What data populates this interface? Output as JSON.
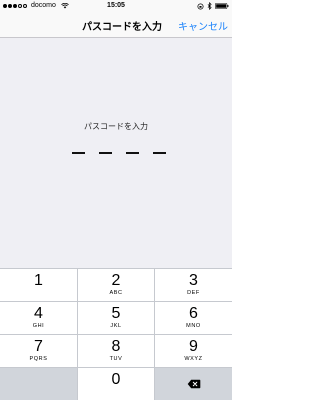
{
  "status_bar": {
    "carrier": "docomo",
    "time": "15:05"
  },
  "nav": {
    "title": "パスコードを入力",
    "cancel_label": "キャンセル"
  },
  "passcode": {
    "prompt": "パスコードを入力",
    "digits_entered": 0,
    "length": 4
  },
  "keypad": {
    "keys": [
      {
        "num": "1",
        "letters": ""
      },
      {
        "num": "2",
        "letters": "ABC"
      },
      {
        "num": "3",
        "letters": "DEF"
      },
      {
        "num": "4",
        "letters": "GHI"
      },
      {
        "num": "5",
        "letters": "JKL"
      },
      {
        "num": "6",
        "letters": "MNO"
      },
      {
        "num": "7",
        "letters": "PQRS"
      },
      {
        "num": "8",
        "letters": "TUV"
      },
      {
        "num": "9",
        "letters": "WXYZ"
      },
      {
        "num": "0",
        "letters": ""
      }
    ]
  },
  "colors": {
    "accent": "#1a82fb",
    "background": "#efeff4",
    "key_background": "#ffffff",
    "keypad_background": "#c6c9cf"
  }
}
